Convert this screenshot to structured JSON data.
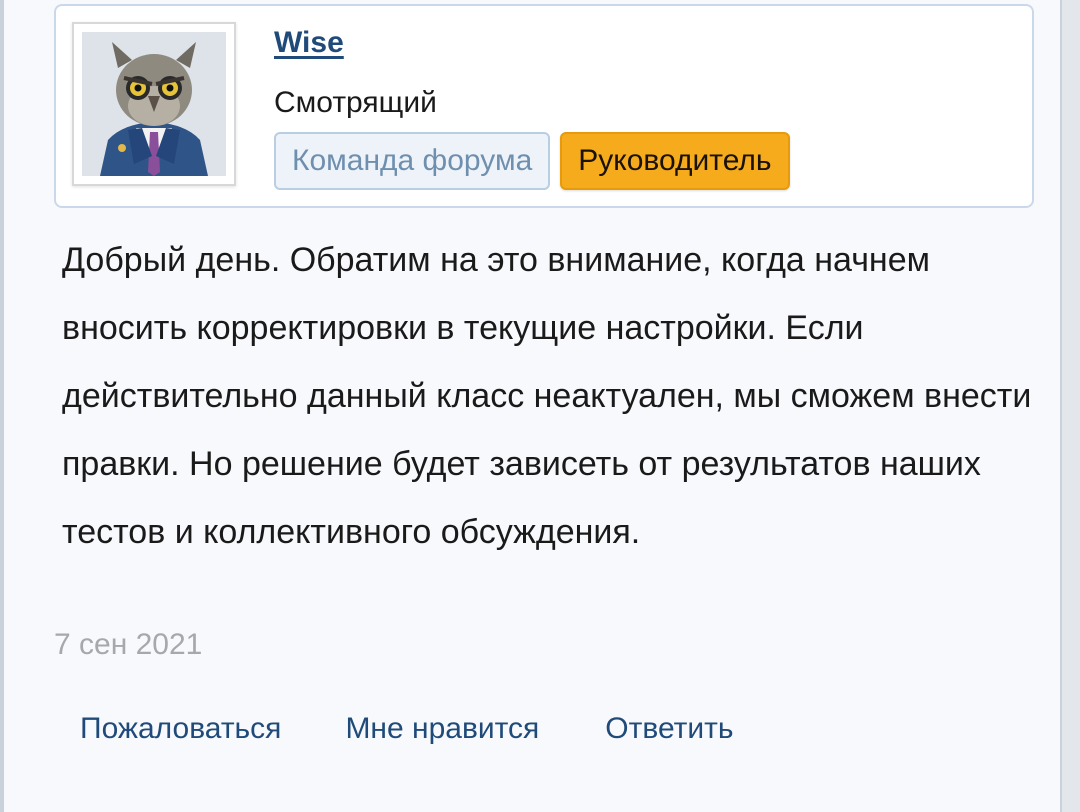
{
  "author": {
    "username": "Wise",
    "title": "Смотрящий",
    "avatar_icon": "owl-in-suit-avatar",
    "banners": [
      {
        "label": "Команда форума",
        "color": "#eef3f9"
      },
      {
        "label": "Руководитель",
        "color": "#f5ab1c"
      }
    ]
  },
  "message": {
    "text": "Добрый день. Обратим на это внимание, когда начнем вносить корректировки в текущие настройки. Если действительно данный класс неактуален, мы сможем внести правки. Но решение будет зависеть от результатов наших тестов и коллективного обсуждения."
  },
  "meta": {
    "date": "7 сен 2021"
  },
  "actions": {
    "report": "Пожаловаться",
    "like": "Мне нравится",
    "reply": "Ответить"
  },
  "colors": {
    "link": "#1f4a7a",
    "accent": "#f5ab1c",
    "box_border": "#cad9ea"
  }
}
